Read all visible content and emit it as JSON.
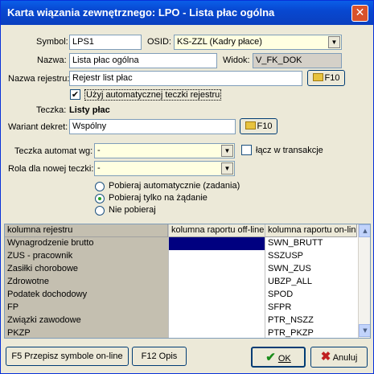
{
  "window": {
    "title": "Karta wiązania zewnętrznego: LPO - Lista płac ogólna",
    "close_label": "✕"
  },
  "form": {
    "symbol_label": "Symbol:",
    "symbol_value": "LPS1",
    "osid_label": "OSID:",
    "osid_value": "KS-ZZL (Kadry płace)",
    "nazwa_label": "Nazwa:",
    "nazwa_value": "Lista płac ogólna",
    "widok_label": "Widok:",
    "widok_value": "V_FK_DOK",
    "rejestr_label": "Nazwa rejestru:",
    "rejestr_value": "Rejestr list płac",
    "auto_teczki_label": "Użyj automatycznej teczki rejestru",
    "auto_teczki_checked": true,
    "teczka_label": "Teczka:",
    "teczka_value": "Listy płac",
    "wariant_label": "Wariant dekret:",
    "wariant_value": "Wspólny",
    "teczka_automat_label": "Teczka automat wg:",
    "teczka_automat_value": "-",
    "lacz_label": "łącz w transakcje",
    "lacz_checked": false,
    "rola_label": "Rola dla nowej teczki:",
    "rola_value": "-",
    "f10_label": "F10"
  },
  "radios": [
    {
      "label": "Pobieraj automatycznie (zadania)",
      "selected": false
    },
    {
      "label": "Pobieraj tylko na żądanie",
      "selected": true
    },
    {
      "label": "Nie pobieraj",
      "selected": false
    }
  ],
  "grid": {
    "headers": [
      "kolumna rejestru",
      "kolumna raportu off-line",
      "kolumna raportu on-line"
    ],
    "rows": [
      [
        "Wynagrodzenie brutto",
        "",
        "SWN_BRUTT"
      ],
      [
        "ZUS - pracownik",
        "",
        "SSZUSP"
      ],
      [
        "Zasiłki chorobowe",
        "",
        "SWN_ZUS"
      ],
      [
        "Zdrowotne",
        "",
        "UBZP_ALL"
      ],
      [
        "Podatek dochodowy",
        "",
        "SPOD"
      ],
      [
        "FP",
        "",
        "SFPR"
      ],
      [
        "Związki zawodowe",
        "",
        "PTR_NSZZ"
      ],
      [
        "PKZP",
        "",
        "PTR_PKZP"
      ]
    ],
    "selected_cell_color": "#000080"
  },
  "buttons": {
    "f5_label": "F5 Przepisz symbole on-line",
    "f12_label": "F12 Opis",
    "ok_label": "OK",
    "cancel_label": "Anuluj"
  },
  "colors": {
    "titlebar": "#0a4fd8",
    "ok_check": "#1a8c1a",
    "cancel_x": "#c02020",
    "yellow_field": "#ffffe1"
  }
}
